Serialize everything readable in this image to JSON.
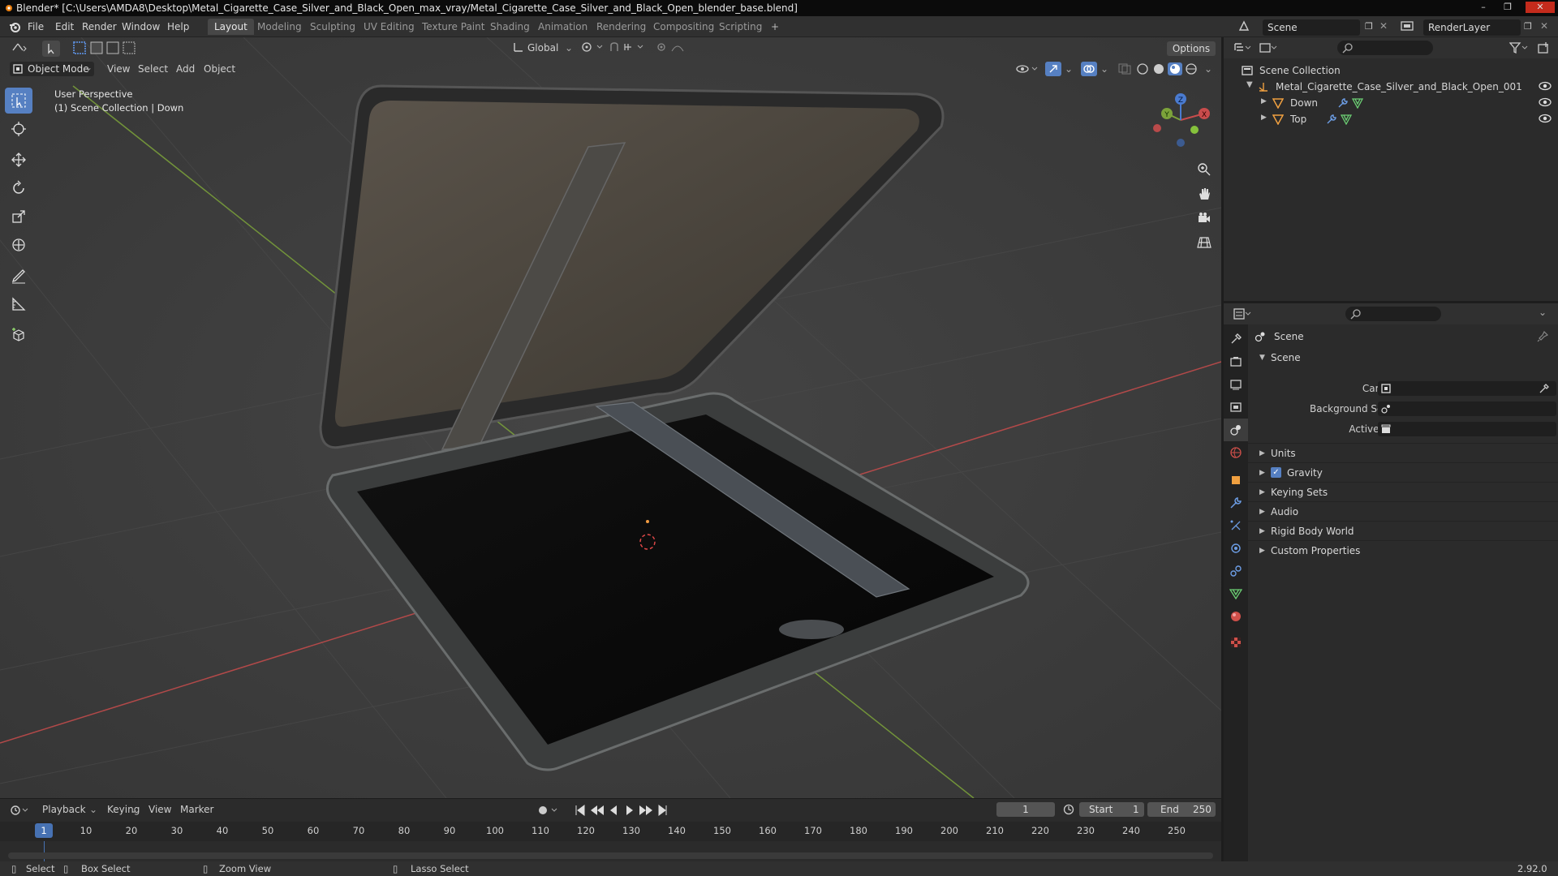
{
  "title_bar": {
    "text": "Blender* [C:\\Users\\AMDA8\\Desktop\\Metal_Cigarette_Case_Silver_and_Black_Open_max_vray/Metal_Cigarette_Case_Silver_and_Black_Open_blender_base.blend]"
  },
  "menu": [
    "File",
    "Edit",
    "Render",
    "Window",
    "Help"
  ],
  "workspaces": [
    "Layout",
    "Modeling",
    "Sculpting",
    "UV Editing",
    "Texture Paint",
    "Shading",
    "Animation",
    "Rendering",
    "Compositing",
    "Scripting"
  ],
  "active_workspace": "Layout",
  "scene_field": "Scene",
  "view_layer_field": "RenderLayer",
  "viewport_header": {
    "transform_orientation": "Global",
    "options": "Options",
    "mode": "Object Mode",
    "menus": [
      "View",
      "Select",
      "Add",
      "Object"
    ]
  },
  "viewport_overlay": {
    "line1": "User Perspective",
    "line2": "(1) Scene Collection | Down"
  },
  "gizmo": {
    "x": "X",
    "y": "Y",
    "z": "Z"
  },
  "outliner": {
    "root": "Scene Collection",
    "items": [
      {
        "name": "Metal_Cigarette_Case_Silver_and_Black_Open_001",
        "level": 1
      },
      {
        "name": "Down",
        "level": 2
      },
      {
        "name": "Top",
        "level": 2
      }
    ]
  },
  "properties": {
    "context": "Scene",
    "section": "Scene",
    "fields": [
      {
        "label": "Camera"
      },
      {
        "label": "Background Scene"
      },
      {
        "label": "Active Clip"
      }
    ],
    "panels": [
      {
        "label": "Units",
        "checkbox": false
      },
      {
        "label": "Gravity",
        "checkbox": true
      },
      {
        "label": "Keying Sets",
        "checkbox": false
      },
      {
        "label": "Audio",
        "checkbox": false
      },
      {
        "label": "Rigid Body World",
        "checkbox": false
      },
      {
        "label": "Custom Properties",
        "checkbox": false
      }
    ]
  },
  "timeline": {
    "menus": [
      "Playback",
      "Keying",
      "View",
      "Marker"
    ],
    "current_frame": "1",
    "start_label": "Start",
    "start": "1",
    "end_label": "End",
    "end": "250",
    "ticks": [
      "1",
      "10",
      "20",
      "30",
      "40",
      "50",
      "60",
      "70",
      "80",
      "90",
      "100",
      "110",
      "120",
      "130",
      "140",
      "150",
      "160",
      "170",
      "180",
      "190",
      "200",
      "210",
      "220",
      "230",
      "240",
      "250"
    ]
  },
  "status_bar": {
    "select": "Select",
    "box_select": "Box Select",
    "zoom_view": "Zoom View",
    "lasso_select": "Lasso Select",
    "version": "2.92.0"
  },
  "colors": {
    "accent": "#5680c2",
    "axis_x": "#c84c4c",
    "axis_y": "#7ca33a",
    "viewport_bg": "#3d3d3d"
  }
}
